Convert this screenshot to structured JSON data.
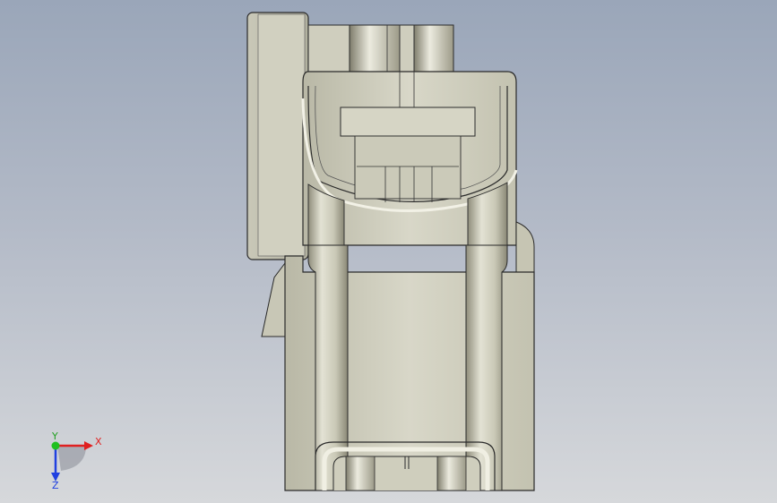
{
  "viewport": {
    "colors": {
      "background_top": "#9aa6b9",
      "background_bottom": "#d6d8db",
      "part_light": "#d7d6c6",
      "part_mid": "#bdbcab",
      "part_shadow": "#8a8878",
      "edge": "#222222"
    }
  },
  "triad": {
    "x_label": "X",
    "y_label": "Y",
    "z_label": "Z",
    "x_color": "#e02020",
    "y_color": "#20c020",
    "z_color": "#2040e0"
  }
}
